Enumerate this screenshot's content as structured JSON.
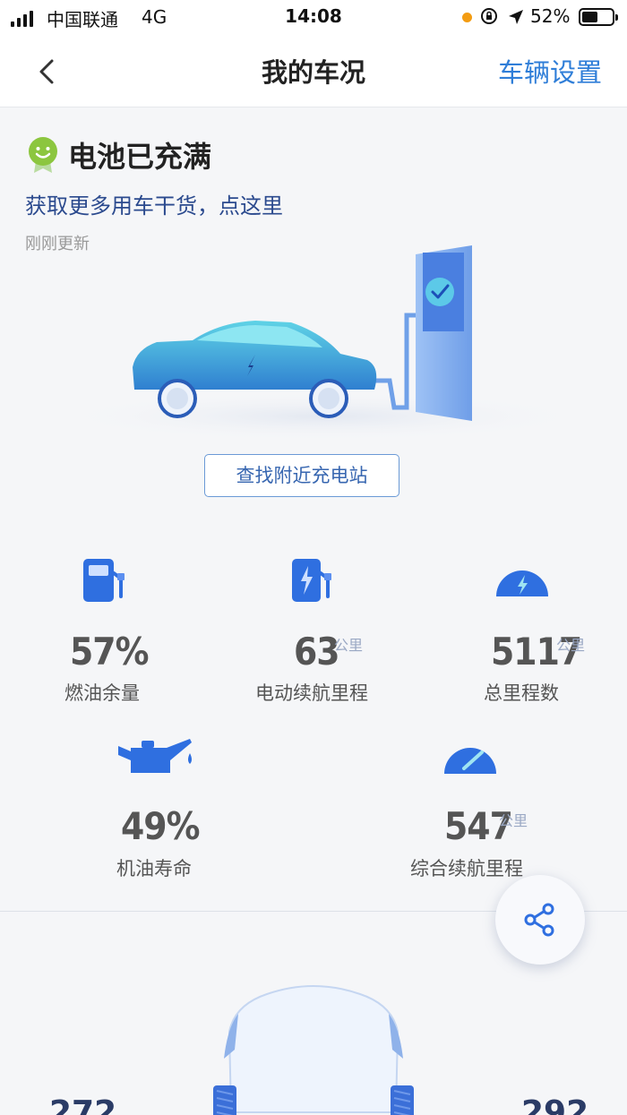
{
  "status_bar": {
    "carrier": "中国联通",
    "network": "4G",
    "time": "14:08",
    "battery_percent": "52%",
    "battery_level": 0.52
  },
  "nav": {
    "title": "我的车况",
    "action": "车辆设置"
  },
  "battery_status": {
    "title": "电池已充满",
    "tips_link": "获取更多用车干货，点这里",
    "updated": "刚刚更新"
  },
  "find_station_button": "查找附近充电站",
  "stats": {
    "fuel": {
      "value": "57%",
      "unit": "",
      "label": "燃油余量"
    },
    "electric_range": {
      "value": "63",
      "unit": "公里",
      "label": "电动续航里程"
    },
    "odometer": {
      "value": "5117",
      "unit": "公里",
      "label": "总里程数"
    },
    "oil_life": {
      "value": "49%",
      "unit": "",
      "label": "机油寿命"
    },
    "total_range": {
      "value": "547",
      "unit": "公里",
      "label": "综合续航里程"
    }
  },
  "tyres": {
    "left_partial": "272",
    "right_partial": "292"
  },
  "colors": {
    "accent": "#2f7ed8",
    "icon_blue": "#2f6fe0",
    "link": "#2b4a8e"
  }
}
